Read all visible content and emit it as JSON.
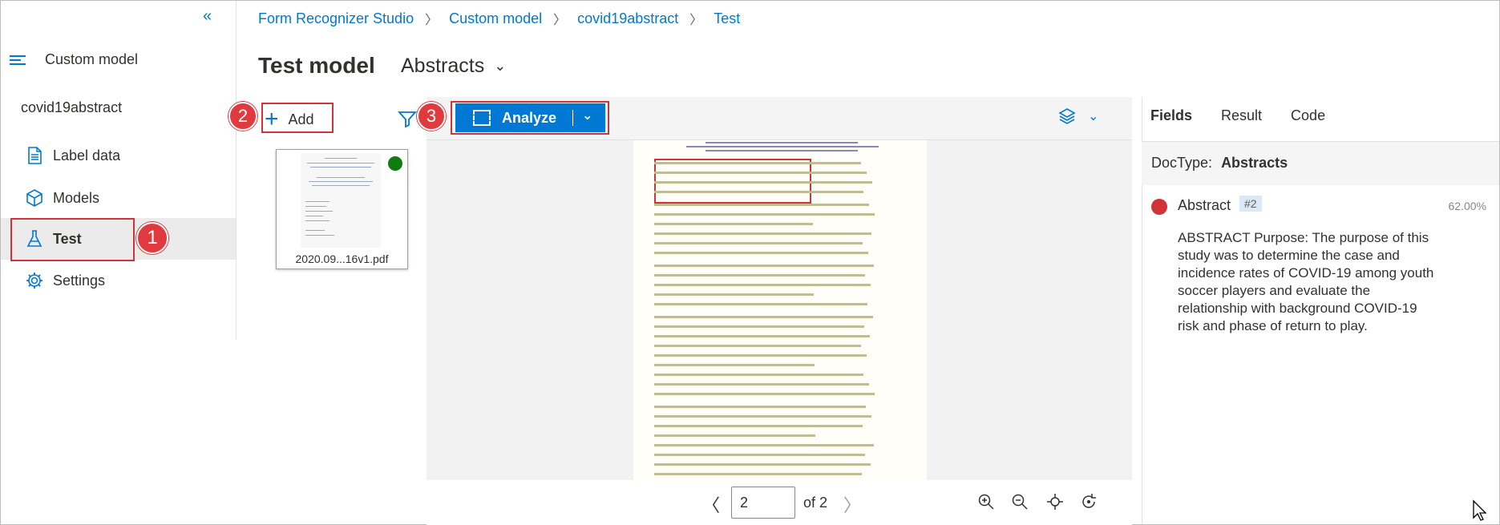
{
  "sidebar": {
    "collapse_glyph": "«",
    "header_label": "Custom model",
    "project_name": "covid19abstract",
    "items": [
      {
        "label": "Label data",
        "icon": "document-icon"
      },
      {
        "label": "Models",
        "icon": "cube-icon"
      },
      {
        "label": "Test",
        "icon": "flask-icon",
        "selected": true
      },
      {
        "label": "Settings",
        "icon": "gear-icon"
      }
    ]
  },
  "breadcrumb": [
    "Form Recognizer Studio",
    "Custom model",
    "covid19abstract",
    "Test"
  ],
  "header": {
    "title": "Test model",
    "doc_type_select": "Abstracts"
  },
  "file_panel": {
    "add_label": "Add",
    "file_name": "2020.09...16v1.pdf"
  },
  "toolbar": {
    "analyze_label": "Analyze"
  },
  "annotations": {
    "step1": "1",
    "step2": "2",
    "step3": "3"
  },
  "pager": {
    "current_page": "2",
    "of_label": "of 2"
  },
  "right_panel": {
    "tabs": [
      "Fields",
      "Result",
      "Code"
    ],
    "active_tab": "Fields",
    "doctype_label": "DocType:",
    "doctype_value": "Abstracts",
    "field": {
      "name": "Abstract",
      "tag": "#2",
      "confidence": "62.00%",
      "value": "ABSTRACT Purpose: The purpose of this study was to determine the case and incidence rates of COVID-19 among youth soccer players and evaluate the relationship with background COVID-19 risk and phase of return to play."
    }
  },
  "colors": {
    "accent": "#0078d4",
    "highlight": "#d13438",
    "field_dot": "#d13438",
    "status_ok": "#107c10"
  }
}
